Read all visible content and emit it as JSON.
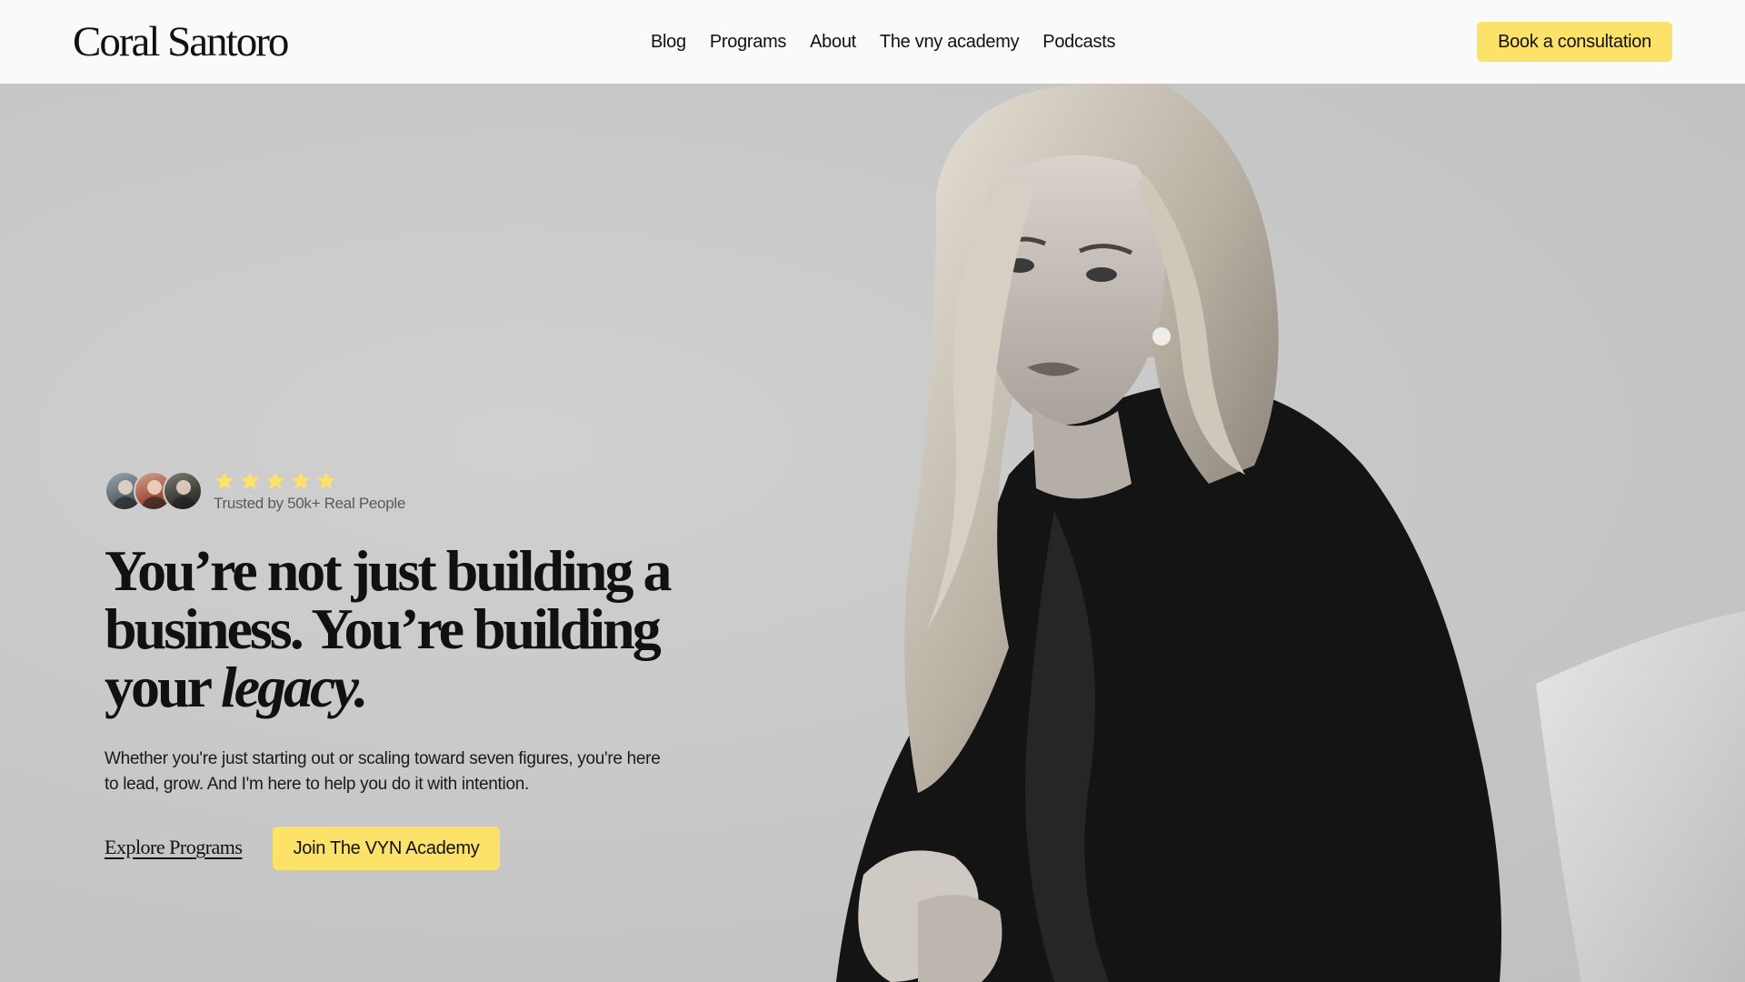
{
  "brand": {
    "logo_text": "Coral Santoro"
  },
  "nav": {
    "items": [
      {
        "label": "Blog"
      },
      {
        "label": "Programs"
      },
      {
        "label": "About"
      },
      {
        "label": "The vny academy"
      },
      {
        "label": "Podcasts"
      }
    ],
    "cta_label": "Book a consultation"
  },
  "hero": {
    "rating_stars": 5,
    "trusted_text": "Trusted by 50k+ Real People",
    "headline_part1": "You’re not just building a business. You’re building your ",
    "headline_emphasis": "legacy.",
    "subtext": "Whether you're just starting out or scaling toward seven figures, you're here to lead, grow. And I'm here to help you do it with intention.",
    "explore_label": "Explore Programs",
    "join_label": "Join The VYN Academy"
  },
  "colors": {
    "accent": "#fde26a",
    "header_bg": "#fafafa",
    "hero_bg": "#c8c8c8",
    "star": "#fde26a"
  },
  "icons": {
    "star": "star-icon"
  }
}
